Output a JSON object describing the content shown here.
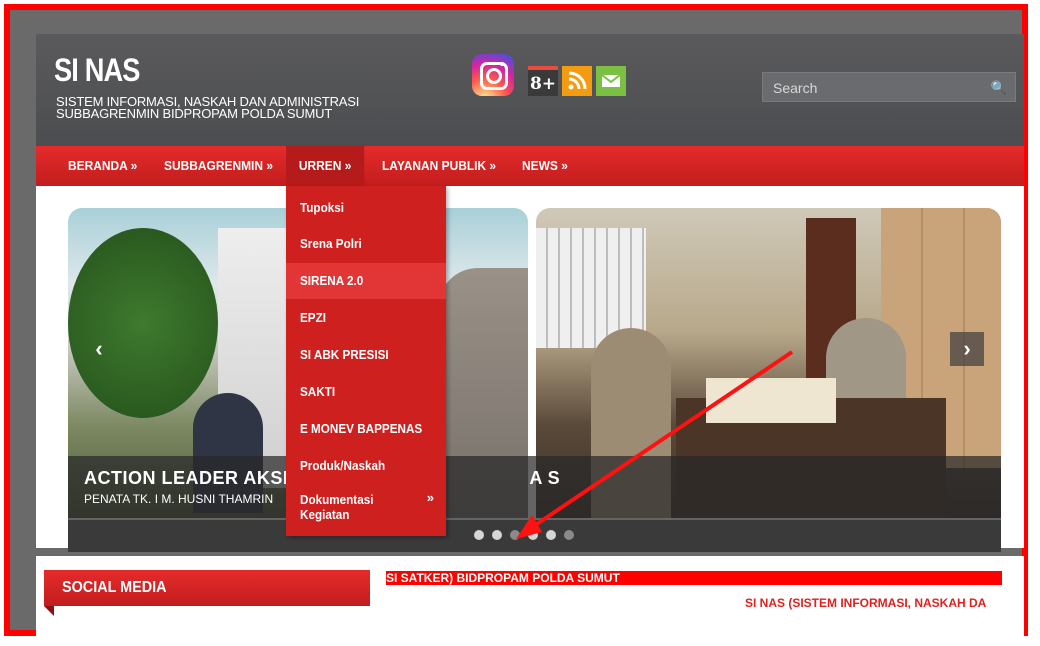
{
  "site": {
    "logo": "SI NAS",
    "subtitle_line1": "SISTEM INFORMASI, NASKAH DAN ADMINISTRASI",
    "subtitle_line2": "SUBBAGRENMIN BIDPROPAM POLDA SUMUT"
  },
  "social_icons": [
    "instagram-icon",
    "google-plus-icon",
    "rss-icon",
    "mail-icon"
  ],
  "google_plus_glyph": "8+",
  "search": {
    "placeholder": "Search"
  },
  "nav": {
    "items": [
      {
        "label": "BERANDA »"
      },
      {
        "label": "SUBBAGRENMIN »"
      },
      {
        "label": "URREN »"
      },
      {
        "label": "LAYANAN PUBLIK »"
      },
      {
        "label": "NEWS »"
      }
    ],
    "active_index": 2
  },
  "dropdown": {
    "items": [
      {
        "label": "Tupoksi"
      },
      {
        "label": "Srena Polri"
      },
      {
        "label": "SIRENA 2.0"
      },
      {
        "label": "EPZI"
      },
      {
        "label": "SI ABK PRESISI"
      },
      {
        "label": "SAKTI"
      },
      {
        "label": "E MONEV BAPPENAS"
      },
      {
        "label": "Produk/Naskah"
      },
      {
        "label": "Dokumentasi Kegiatan",
        "line1": "Dokumentasi",
        "line2": "Kegiatan",
        "arrow": "»"
      }
    ],
    "hovered_index": 2
  },
  "slider": {
    "caption_title": "ACTION LEADER AKSI I",
    "caption_title_tail": "A S",
    "caption_sub": "PENATA TK. I M. HUSNI THAMRIN",
    "prev": "‹",
    "next": "›",
    "dot_count": 6,
    "active_dot": 2
  },
  "social_section": {
    "title": "SOCIAL MEDIA"
  },
  "marquee": {
    "line1": "SI SATKER) BIDPROPAM POLDA SUMUT",
    "line2": "SI NAS (SISTEM INFORMASI, NASKAH DA"
  },
  "colors": {
    "accent_red": "#d22222",
    "frame_red": "#ff0000",
    "header_gray": "#545558"
  }
}
